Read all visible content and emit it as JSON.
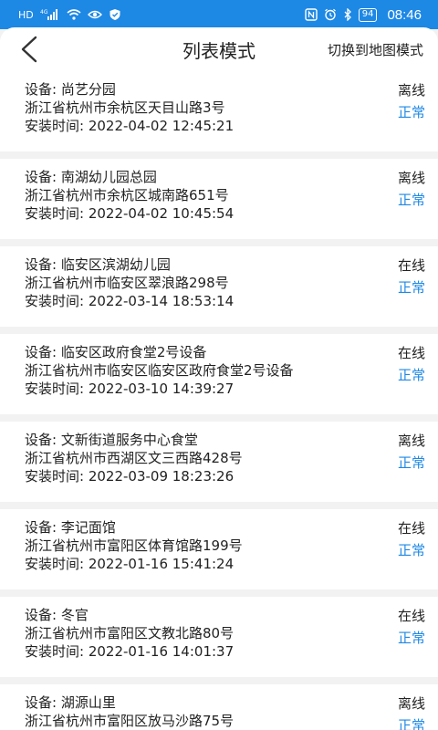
{
  "status_bar": {
    "hd": "HD",
    "signal": "4G",
    "battery": "94",
    "time": "08:46"
  },
  "header": {
    "title": "列表模式",
    "switch_label": "切换到地图模式"
  },
  "devices": [
    {
      "name": "设备: 尚艺分园",
      "address": "浙江省杭州市余杭区天目山路3号",
      "install_time": "安装时间: 2022-04-02 12:45:21",
      "online_status": "离线",
      "health_status": "正常"
    },
    {
      "name": "设备: 南湖幼儿园总园",
      "address": "浙江省杭州市余杭区城南路651号",
      "install_time": "安装时间: 2022-04-02 10:45:54",
      "online_status": "离线",
      "health_status": "正常"
    },
    {
      "name": "设备: 临安区滨湖幼儿园",
      "address": "浙江省杭州市临安区翠浪路298号",
      "install_time": "安装时间: 2022-03-14 18:53:14",
      "online_status": "在线",
      "health_status": "正常"
    },
    {
      "name": "设备: 临安区政府食堂2号设备",
      "address": "浙江省杭州市临安区临安区政府食堂2号设备",
      "install_time": "安装时间: 2022-03-10 14:39:27",
      "online_status": "在线",
      "health_status": "正常"
    },
    {
      "name": "设备: 文新街道服务中心食堂",
      "address": "浙江省杭州市西湖区文三西路428号",
      "install_time": "安装时间: 2022-03-09 18:23:26",
      "online_status": "离线",
      "health_status": "正常"
    },
    {
      "name": "设备: 李记面馆",
      "address": "浙江省杭州市富阳区体育馆路199号",
      "install_time": "安装时间: 2022-01-16 15:41:24",
      "online_status": "在线",
      "health_status": "正常"
    },
    {
      "name": "设备: 冬官",
      "address": "浙江省杭州市富阳区文教北路80号",
      "install_time": "安装时间: 2022-01-16 14:01:37",
      "online_status": "在线",
      "health_status": "正常"
    },
    {
      "name": "设备: 湖源山里",
      "address": "浙江省杭州市富阳区放马沙路75号",
      "install_time": "",
      "online_status": "离线",
      "health_status": "正常"
    }
  ],
  "colors": {
    "status_bar_bg": "#1e88e5",
    "accent_blue": "#1e88e5"
  }
}
